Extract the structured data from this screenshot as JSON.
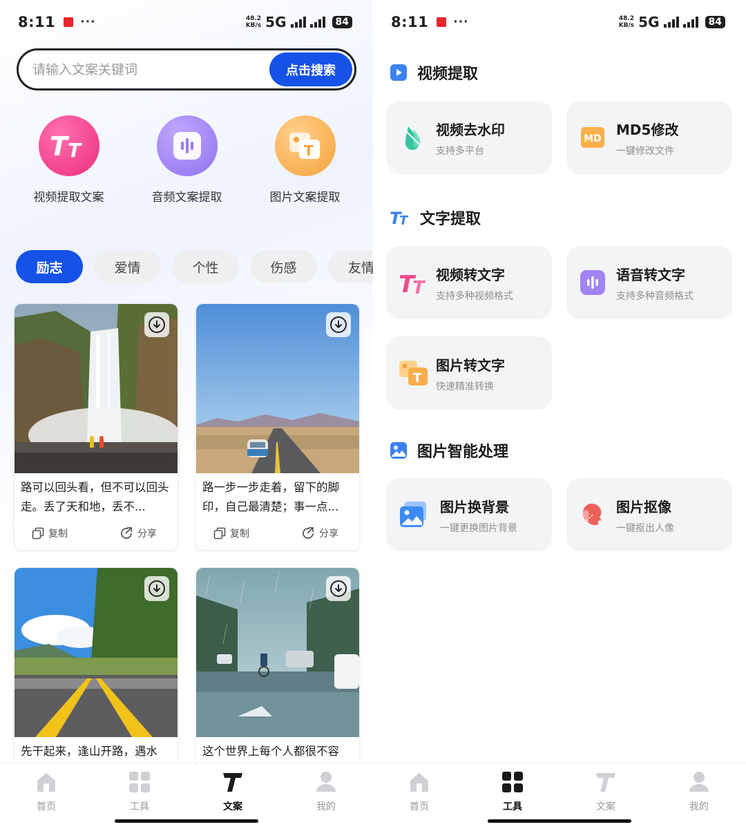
{
  "status_bar": {
    "time": "8:11",
    "dots": "···",
    "speed_value": "48.2",
    "speed_unit": "KB/s",
    "network": "5G",
    "battery": "84"
  },
  "search": {
    "placeholder": "请输入文案关键词",
    "button_label": "点击搜索"
  },
  "features": [
    {
      "label": "视频提取文案",
      "icon": "tt-text-icon",
      "color": "#f3478d"
    },
    {
      "label": "音频文案提取",
      "icon": "audio-wave-icon",
      "color": "#9a7cf2"
    },
    {
      "label": "图片文案提取",
      "icon": "image-text-icon",
      "color": "#f8ae4c"
    }
  ],
  "categories": [
    {
      "label": "励志",
      "active": true
    },
    {
      "label": "爱情"
    },
    {
      "label": "个性"
    },
    {
      "label": "伤感"
    },
    {
      "label": "友情"
    }
  ],
  "cards": [
    {
      "text": "路可以回头看，但不可以回头走。丢了天和地，丢不...",
      "image": "waterfall",
      "copy": "复制",
      "share": "分享"
    },
    {
      "text": "路一步一步走着，留下的脚印，自己最清楚；事一点...",
      "image": "desert-road",
      "copy": "复制",
      "share": "分享"
    },
    {
      "text": "先干起来，逢山开路，遇水",
      "image": "mountain-road"
    },
    {
      "text": "这个世界上每个人都很不容",
      "image": "rainy-street"
    }
  ],
  "tabbar": [
    {
      "label": "首页",
      "icon": "home-icon"
    },
    {
      "label": "工具",
      "icon": "grid-icon"
    },
    {
      "label": "文案",
      "icon": "text-t-icon"
    },
    {
      "label": "我的",
      "icon": "user-icon"
    }
  ],
  "tabbar_active_left": "文案",
  "tabbar_active_right": "工具",
  "tools": {
    "sections": [
      {
        "title": "视频提取",
        "icon": "video-play-icon",
        "items": [
          {
            "title": "视频去水印",
            "subtitle": "支持多平台",
            "icon": "watermark-drop-icon"
          },
          {
            "title": "MD5修改",
            "subtitle": "一键修改文件",
            "icon": "md5-icon",
            "icon_text": "MD"
          }
        ]
      },
      {
        "title": "文字提取",
        "icon": "tt-text-icon",
        "items": [
          {
            "title": "视频转文字",
            "subtitle": "支持多种视频格式",
            "icon": "tt-text-icon"
          },
          {
            "title": "语音转文字",
            "subtitle": "支持多种音频格式",
            "icon": "audio-wave-icon"
          },
          {
            "title": "图片转文字",
            "subtitle": "快速精准转换",
            "icon": "image-text-icon"
          }
        ]
      },
      {
        "title": "图片智能处理",
        "icon": "image-icon",
        "items": [
          {
            "title": "图片换背景",
            "subtitle": "一键更换图片背景",
            "icon": "image-swap-icon"
          },
          {
            "title": "图片抠像",
            "subtitle": "一键抠出人像",
            "icon": "portrait-cutout-icon"
          }
        ]
      }
    ]
  },
  "colors": {
    "accent": "#1652e8",
    "card_bg": "#f3f4f6",
    "chip_bg": "#efeff1"
  }
}
